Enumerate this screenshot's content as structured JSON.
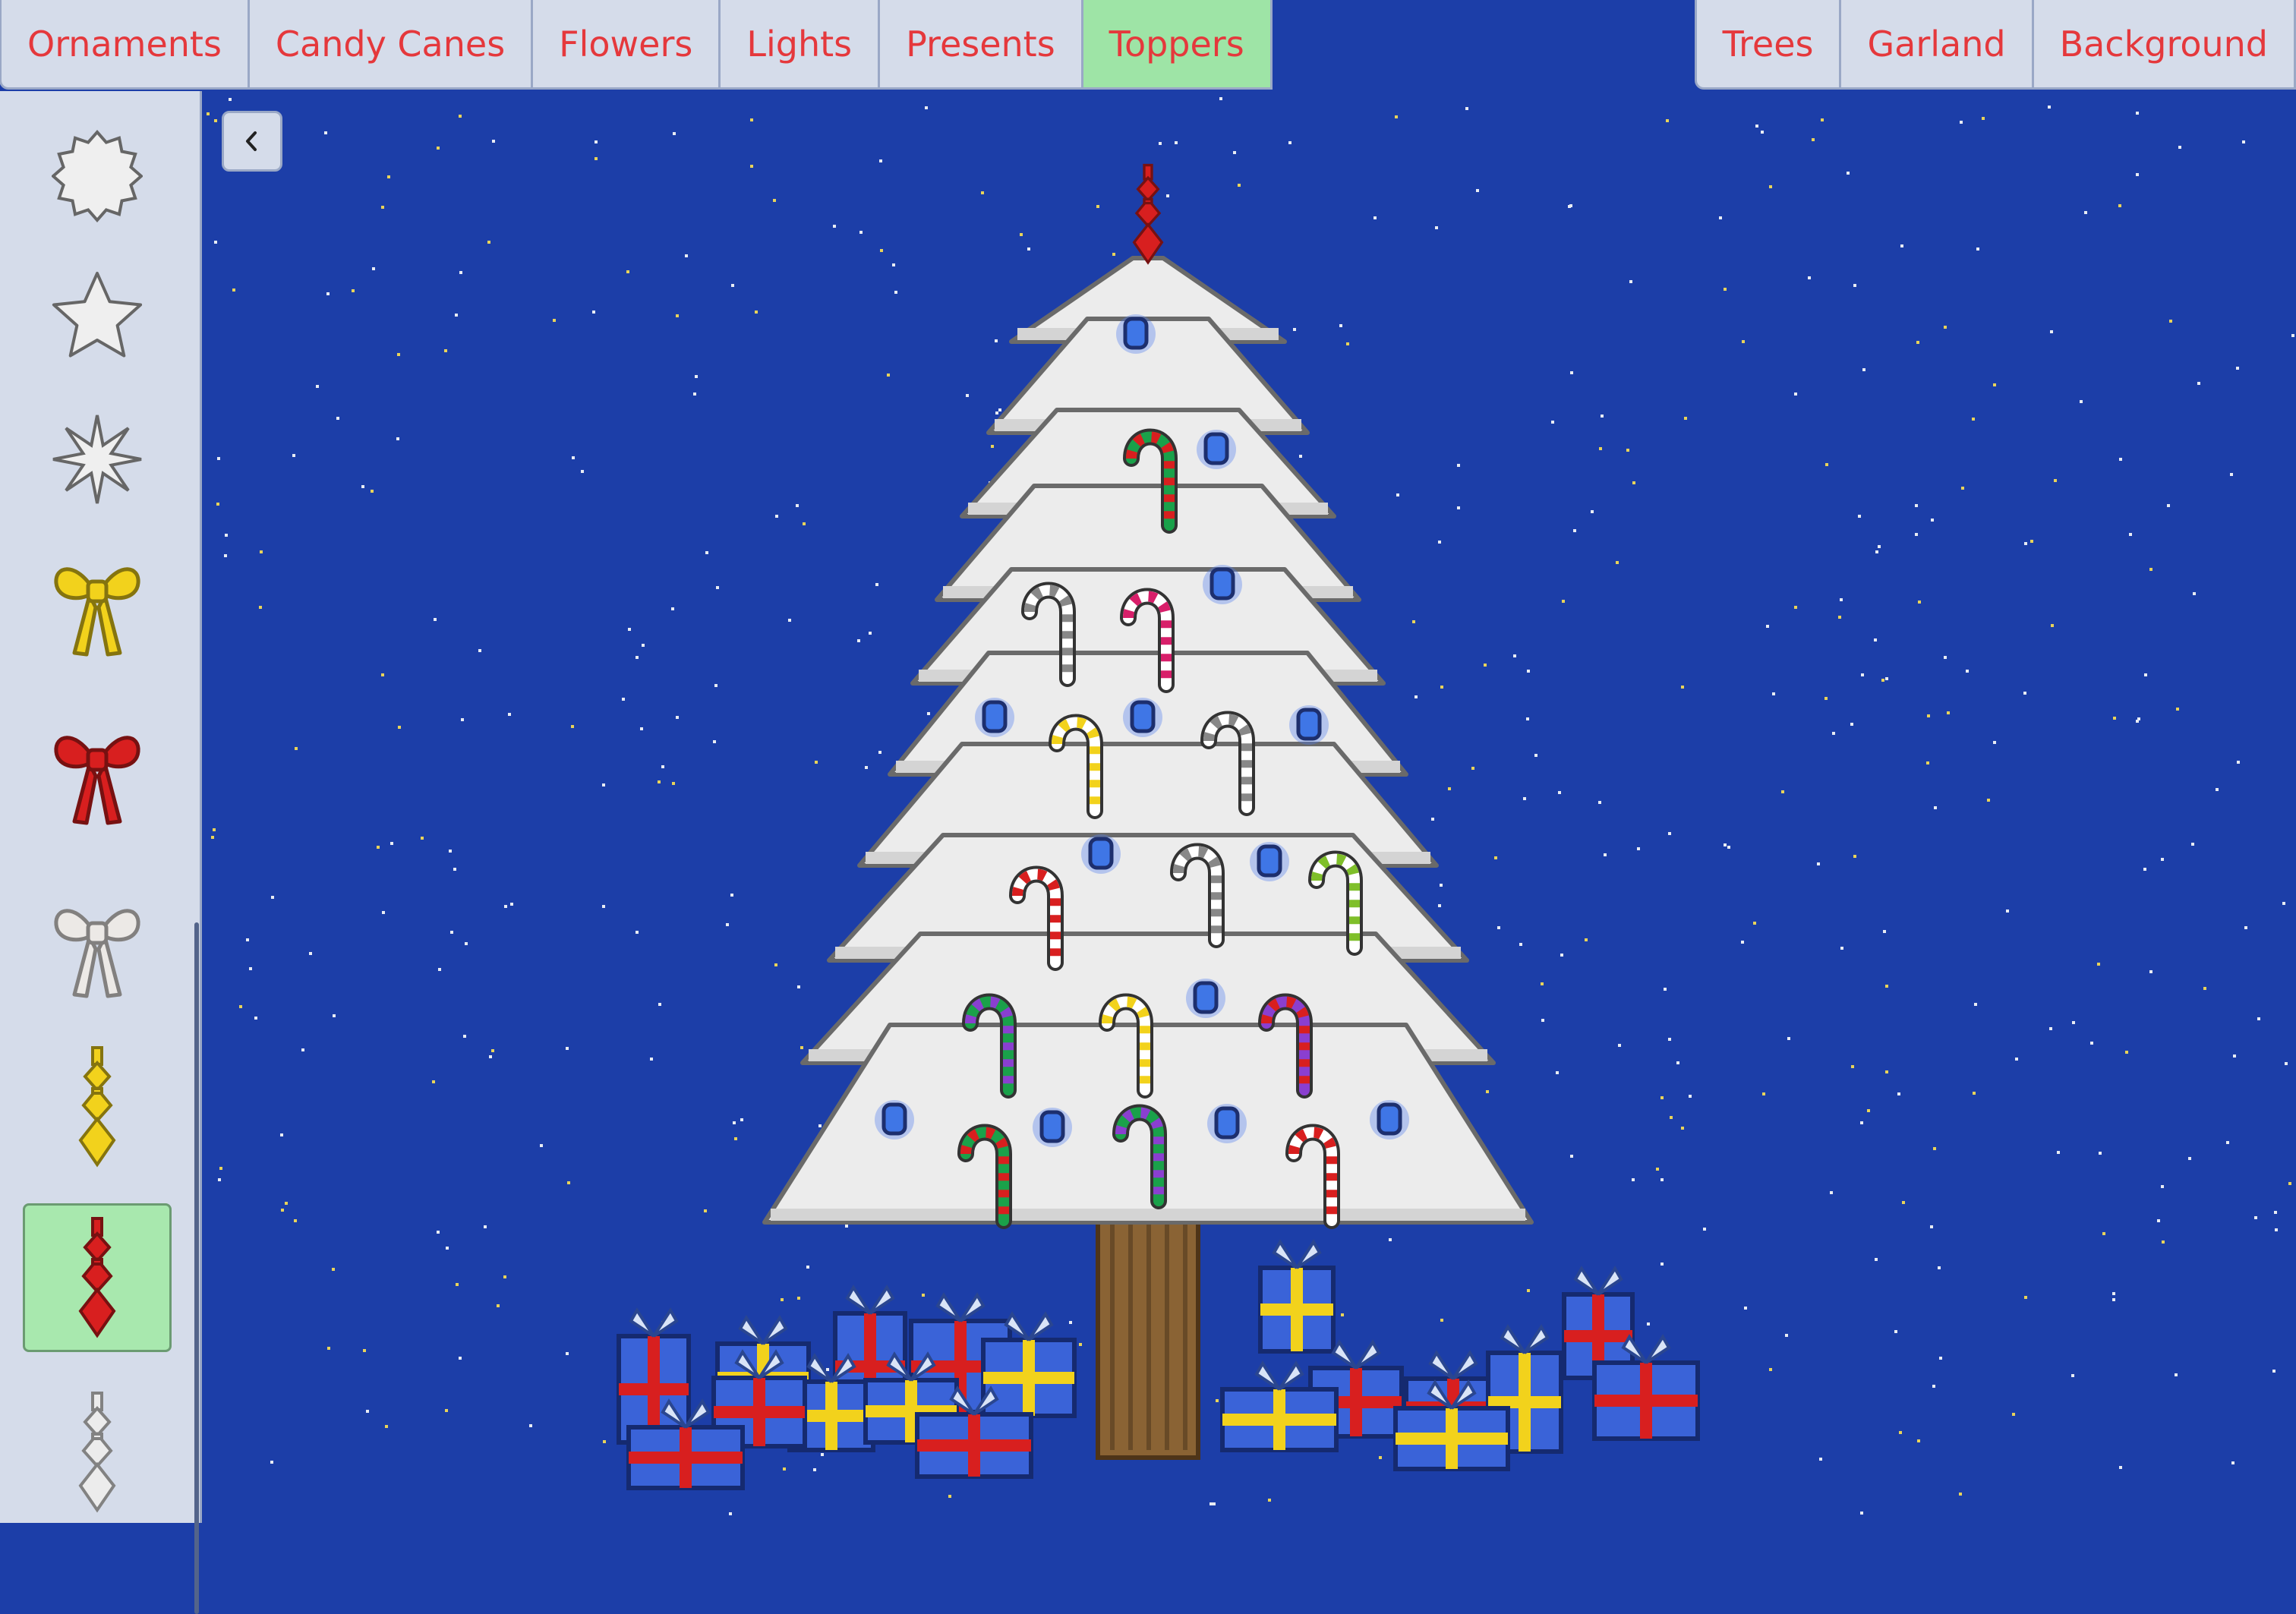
{
  "tabs_left": [
    {
      "label": "Ornaments",
      "active": false
    },
    {
      "label": "Candy Canes",
      "active": false
    },
    {
      "label": "Flowers",
      "active": false
    },
    {
      "label": "Lights",
      "active": false
    },
    {
      "label": "Presents",
      "active": false
    },
    {
      "label": "Toppers",
      "active": true
    }
  ],
  "tabs_right": [
    {
      "label": "Trees"
    },
    {
      "label": "Garland"
    },
    {
      "label": "Background"
    }
  ],
  "sidebar": {
    "selected_index": 7,
    "items": [
      {
        "icon": "white-snowflake-star-topper-icon",
        "color": "#efefef"
      },
      {
        "icon": "white-star-topper-icon",
        "color": "#efefef"
      },
      {
        "icon": "white-sparkle-topper-icon",
        "color": "#efefef"
      },
      {
        "icon": "yellow-bow-topper-icon",
        "color": "#f2d21c"
      },
      {
        "icon": "red-bow-topper-icon",
        "color": "#d81f1f"
      },
      {
        "icon": "white-bow-topper-icon",
        "color": "#ece9e6"
      },
      {
        "icon": "yellow-finial-topper-icon",
        "color": "#f2d21c"
      },
      {
        "icon": "red-finial-topper-icon",
        "color": "#d81f1f"
      },
      {
        "icon": "white-finial-topper-icon",
        "color": "#ececec"
      }
    ]
  },
  "collapse_button": {
    "icon": "chevron-left-icon"
  },
  "scene": {
    "background_color": "#1c3ea8",
    "tree_color": "#ececec",
    "trunk_color": "#8a6334",
    "topper": {
      "icon": "red-finial-topper-icon",
      "color": "#d81f1f"
    }
  },
  "colors": {
    "tab_text": "#e5383c",
    "tab_bg": "#d5dcea",
    "tab_active_bg": "#9ee4a6",
    "light_blue": "#3f76e6"
  }
}
